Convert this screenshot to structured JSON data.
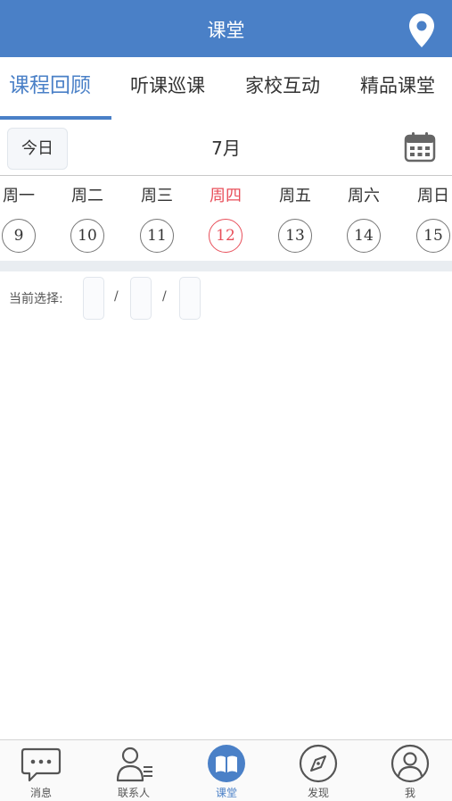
{
  "header": {
    "title": "课堂",
    "location_icon": "map-pin-icon"
  },
  "tabs": [
    {
      "label": "课程回顾",
      "active": true
    },
    {
      "label": "听课巡课",
      "active": false
    },
    {
      "label": "家校互动",
      "active": false
    },
    {
      "label": "精品课堂",
      "active": false
    }
  ],
  "datebar": {
    "today_label": "今日",
    "month_label": "7月",
    "calendar_icon": "calendar-icon"
  },
  "week": [
    {
      "label": "周一",
      "day": "9",
      "current": false
    },
    {
      "label": "周二",
      "day": "10",
      "current": false
    },
    {
      "label": "周三",
      "day": "11",
      "current": false
    },
    {
      "label": "周四",
      "day": "12",
      "current": true
    },
    {
      "label": "周五",
      "day": "13",
      "current": false
    },
    {
      "label": "周六",
      "day": "14",
      "current": false
    },
    {
      "label": "周日",
      "day": "15",
      "current": false
    }
  ],
  "selection": {
    "label": "当前选择:",
    "separator": "/"
  },
  "bottom_nav": [
    {
      "label": "消息",
      "icon": "chat-bubble-icon",
      "active": false
    },
    {
      "label": "联系人",
      "icon": "contacts-icon",
      "active": false
    },
    {
      "label": "课堂",
      "icon": "open-book-icon",
      "active": true
    },
    {
      "label": "发现",
      "icon": "compass-icon",
      "active": false
    },
    {
      "label": "我",
      "icon": "user-icon",
      "active": false
    }
  ],
  "colors": {
    "primary": "#4a80c7",
    "highlight": "#e8505b",
    "strip": "#e9edf1"
  }
}
